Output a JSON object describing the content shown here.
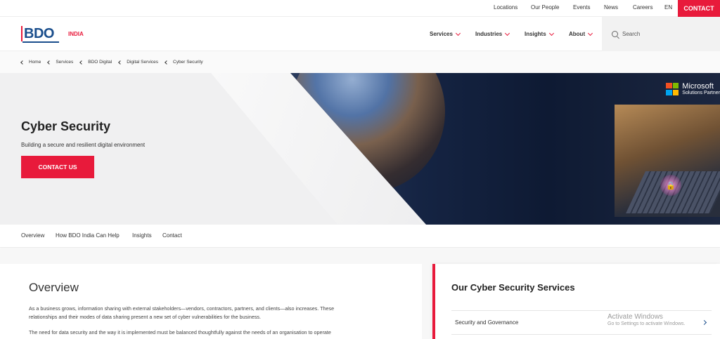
{
  "topbar": {
    "links": [
      "Locations",
      "Our People",
      "Events",
      "News",
      "Careers",
      "EN"
    ],
    "contact_label": "CONTACT"
  },
  "header": {
    "logo_text": "BDO",
    "country": "INDIA",
    "nav": [
      "Services",
      "Industries",
      "Insights",
      "About"
    ],
    "search_placeholder": "Search"
  },
  "breadcrumb": [
    "Home",
    "Services",
    "BDO Digital",
    "Digital Services",
    "Cyber Security"
  ],
  "hero": {
    "title": "Cyber Security",
    "subtitle": "Building a secure and resilient digital environment",
    "button_label": "CONTACT US",
    "badge_line1": "Microsoft",
    "badge_line2": "Solutions Partner"
  },
  "subnav": [
    "Overview",
    "How BDO India Can Help",
    "Insights",
    "Contact"
  ],
  "overview": {
    "title": "Overview",
    "para1_line1": "As a business grows, information sharing with external stakeholders—vendors, contractors, partners, and clients—also increases. These",
    "para1_line2": "relationships and their modes of data sharing present a new set of cyber vulnerabilities for the business.",
    "para2_line1": "The need for data security and the way it is implemented must be balanced thoughtfully against the needs of an organisation to operate"
  },
  "services": {
    "title": "Our Cyber Security Services",
    "items": [
      "Security and Governance"
    ]
  },
  "watermark": {
    "line1": "Activate Windows",
    "line2": "Go to Settings to activate Windows."
  },
  "colors": {
    "brand_red": "#e81a3b",
    "brand_blue": "#1a4e8c"
  }
}
